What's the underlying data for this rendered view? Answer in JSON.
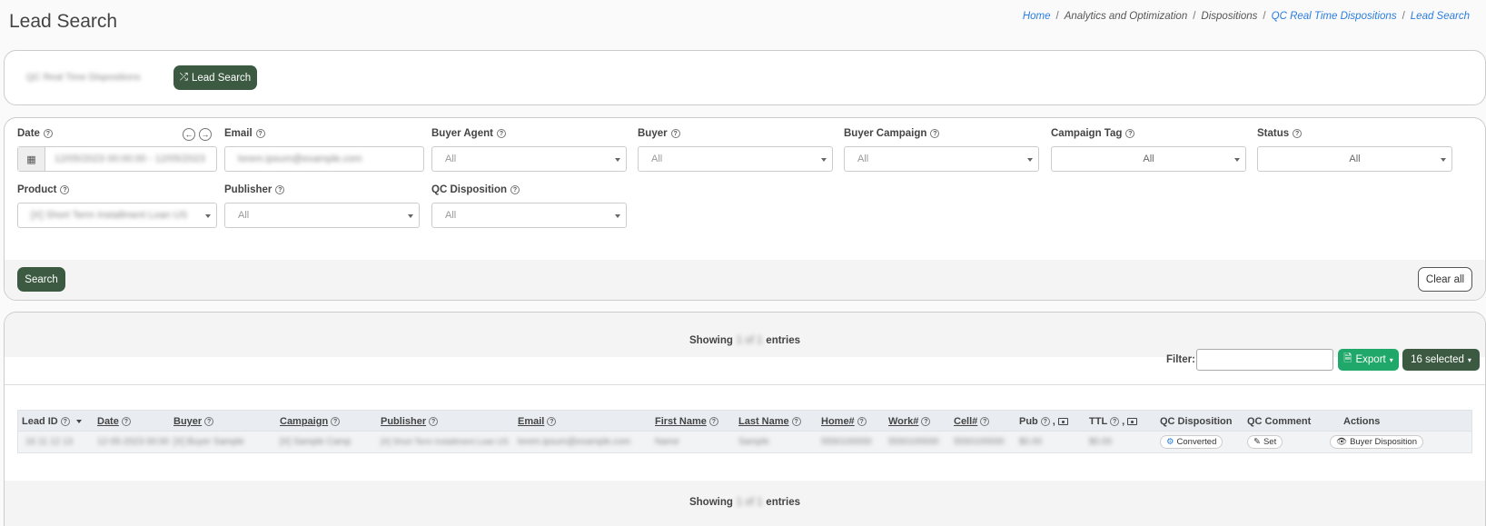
{
  "page": {
    "title": "Lead Search",
    "breadcrumb": [
      "Home",
      "Analytics and Optimization",
      "Dispositions",
      "QC Real Time Dispositions",
      "Lead Search"
    ]
  },
  "tabs": {
    "blurred_tab": "QC Real Time Dispositions",
    "lead_search": "Lead Search",
    "lead_search_icon": "shuffle-icon"
  },
  "filters": {
    "date": {
      "label": "Date",
      "value": "12/05/2023 00:00:00 - 12/05/2023"
    },
    "email": {
      "label": "Email",
      "value": "lorem.ipsum@example.com"
    },
    "buyer_agent": {
      "label": "Buyer Agent",
      "value": "All"
    },
    "buyer": {
      "label": "Buyer",
      "value": "All"
    },
    "buyer_campaign": {
      "label": "Buyer Campaign",
      "value": "All"
    },
    "campaign_tag": {
      "label": "Campaign Tag",
      "value": "All"
    },
    "status": {
      "label": "Status",
      "value": "All"
    },
    "product": {
      "label": "Product",
      "value": "[X] Short Term Installment Loan US"
    },
    "publisher": {
      "label": "Publisher",
      "value": "All"
    },
    "qc_disposition": {
      "label": "QC Disposition",
      "value": "All"
    }
  },
  "actions": {
    "search": "Search",
    "clear_all": "Clear all"
  },
  "results": {
    "showing_prefix": "Showing",
    "showing_count": "1 of 1",
    "showing_suffix": "entries",
    "filter_label": "Filter:",
    "export": "Export",
    "selected": "16 selected"
  },
  "table": {
    "headers": {
      "lead_id": "Lead ID",
      "date": "Date",
      "buyer": "Buyer",
      "campaign": "Campaign",
      "publisher": "Publisher",
      "email": "Email",
      "first_name": "First Name",
      "last_name": "Last Name",
      "home": "Home#",
      "work": "Work#",
      "cell": "Cell#",
      "pub": "Pub",
      "ttl": "TTL",
      "qc_disposition": "QC Disposition",
      "qc_comment": "QC Comment",
      "actions": "Actions"
    },
    "row": {
      "lead_id": "16 11 12 13",
      "date": "12-05-2023 00:00",
      "buyer": "[X] Buyer Sample",
      "campaign": "[X] Sample Camp",
      "publisher": "[X] Short Term Installment Loan US",
      "email": "lorem.ipsum@example.com",
      "first_name": "Name",
      "last_name": "Sample",
      "home": "5550100000",
      "work": "5550100000",
      "cell": "5550100000",
      "pub": "$0.00",
      "ttl": "$0.00",
      "qc_disposition": "Converted",
      "qc_comment": "Set",
      "actions": "Buyer Disposition"
    }
  }
}
